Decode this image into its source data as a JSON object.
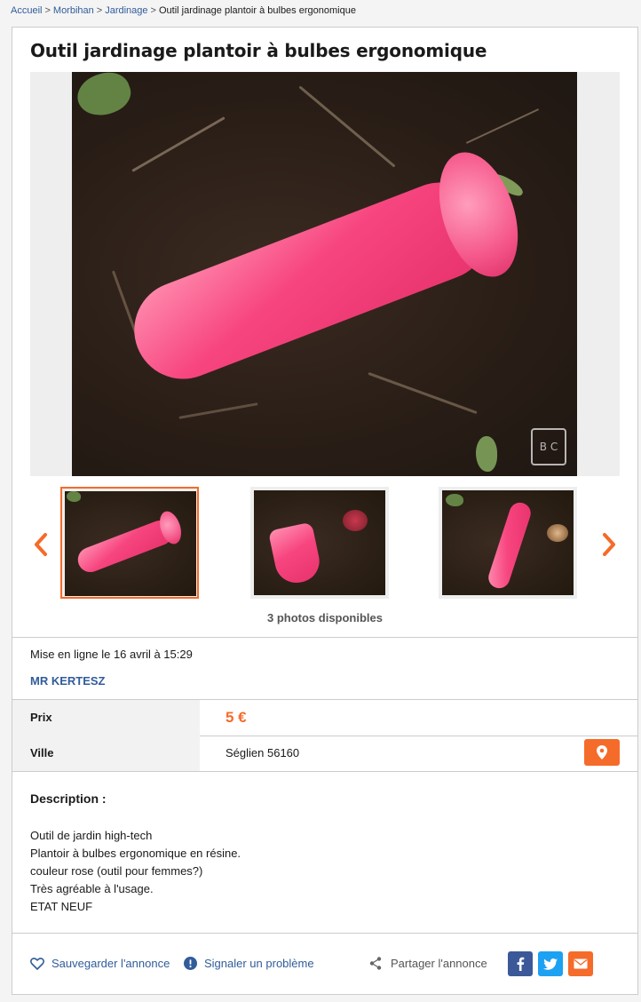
{
  "breadcrumb": {
    "items": [
      "Accueil",
      "Morbihan",
      "Jardinage"
    ],
    "separator": ">",
    "current": "Outil jardinage plantoir à bulbes ergonomique"
  },
  "ad": {
    "title": "Outil jardinage plantoir à bulbes ergonomique",
    "photos_count_label": "3 photos disponibles",
    "posted_label": "Mise en ligne le 16 avril à 15:29",
    "seller_name": "MR KERTESZ"
  },
  "details": {
    "price_label": "Prix",
    "price_value": "5 €",
    "city_label": "Ville",
    "city_value": "Séglien 56160"
  },
  "description": {
    "title": "Description :",
    "lines": [
      "Outil de jardin high-tech",
      "Plantoir à bulbes ergonomique en résine.",
      "couleur rose (outil pour femmes?)",
      "Très agréable à l'usage.",
      "ETAT NEUF"
    ]
  },
  "actions": {
    "save_label": "Sauvegarder l'annonce",
    "report_label": "Signaler un problème",
    "share_label": "Partager l'annonce"
  },
  "colors": {
    "accent": "#f56b2a",
    "link": "#315c9a",
    "facebook": "#3b5998",
    "twitter": "#1da1f2",
    "email": "#f56b2a"
  },
  "icons": {
    "prev": "chevron-left-icon",
    "next": "chevron-right-icon",
    "map": "map-pin-icon",
    "save": "heart-icon",
    "report": "alert-icon",
    "share": "share-icon",
    "facebook": "facebook-icon",
    "twitter": "twitter-icon",
    "email": "email-icon"
  }
}
